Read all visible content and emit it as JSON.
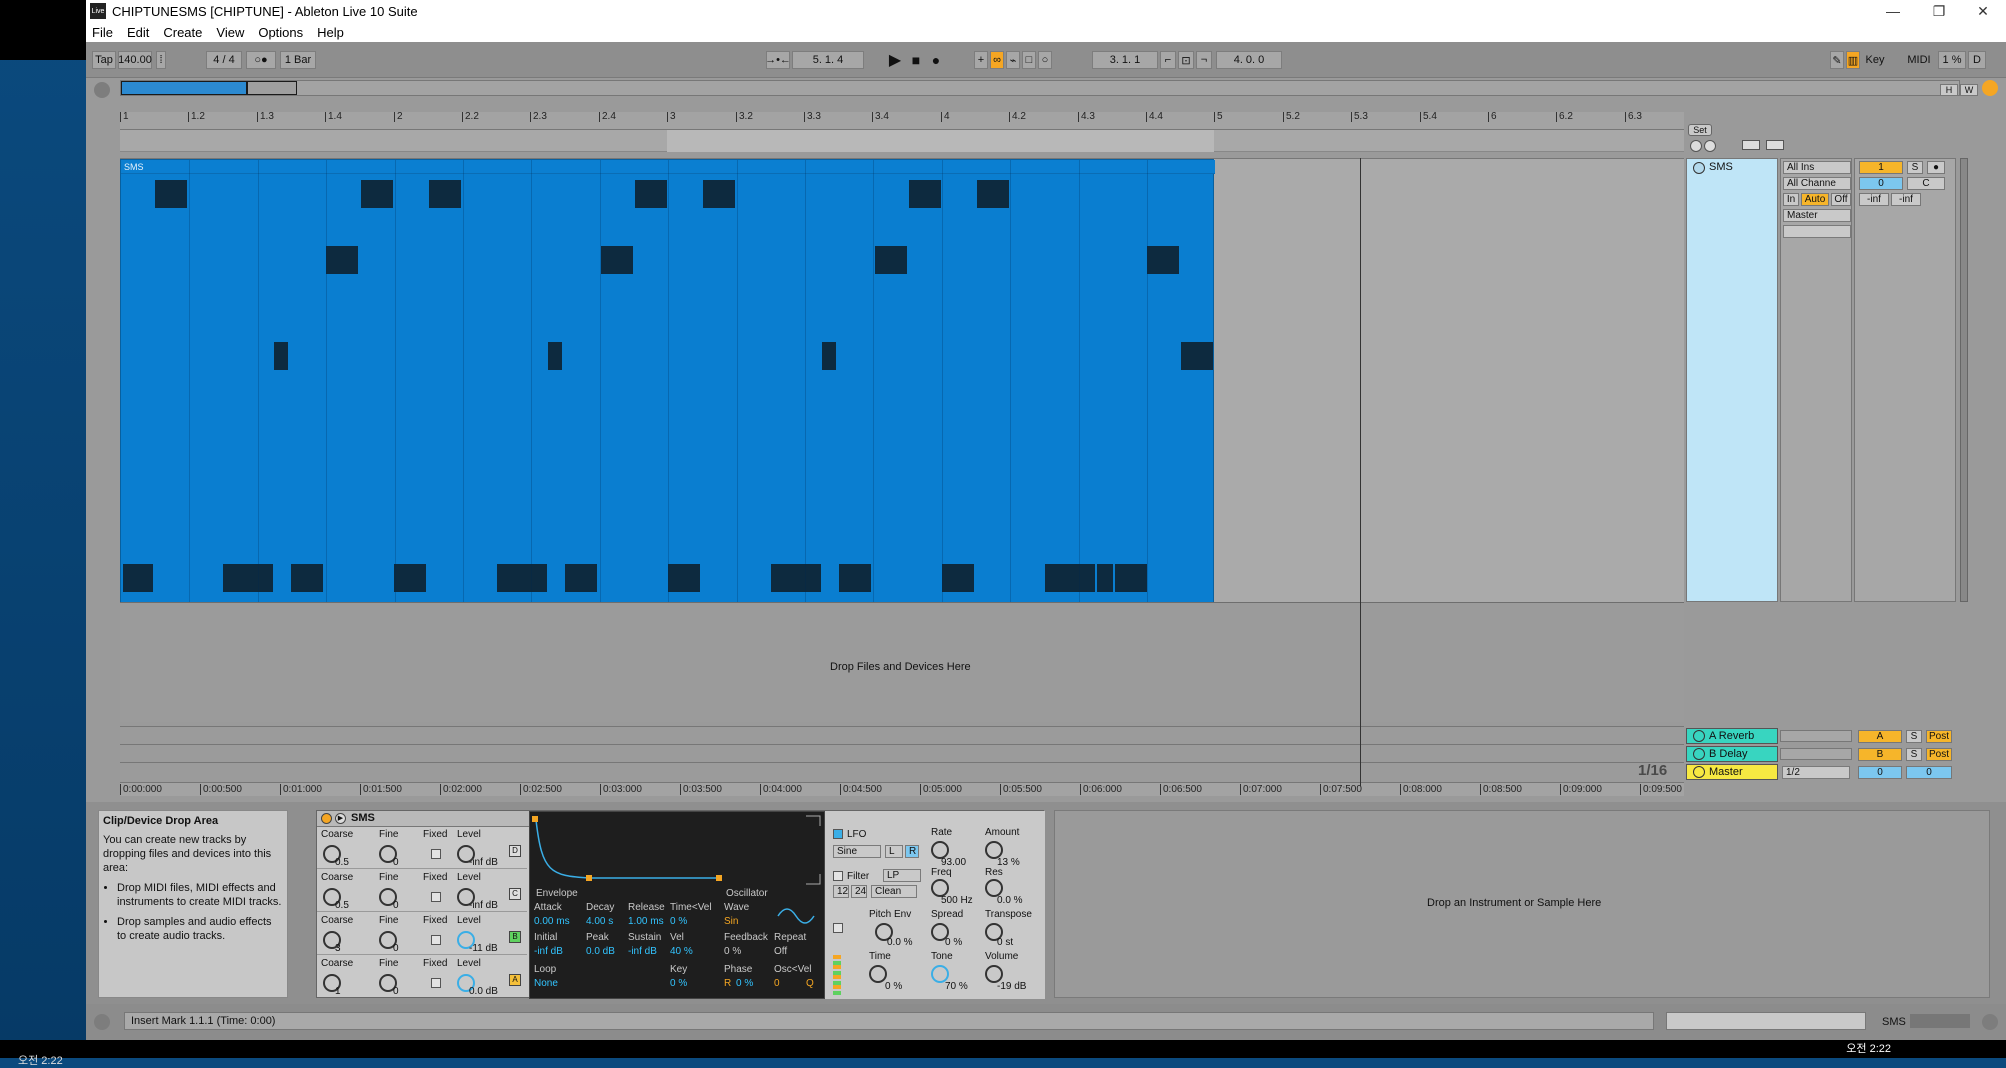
{
  "window": {
    "title": "CHIPTUNESMS  [CHIPTUNE] - Ableton Live 10 Suite",
    "logo": "Live",
    "minimize": "—",
    "restore": "❐",
    "close": "✕"
  },
  "menu": [
    "File",
    "Edit",
    "Create",
    "View",
    "Options",
    "Help"
  ],
  "transport": {
    "tap": "Tap",
    "tempo": "140.00",
    "signature": "4  /  4",
    "quantize": "1 Bar",
    "position": "5.   1.   4",
    "loop_start": "3.   1.   1",
    "loop_length": "4.   0.   0",
    "key": "Key",
    "midi": "MIDI",
    "cpu": "1 %",
    "d": "D"
  },
  "overview": {
    "h_button": "H",
    "w_button": "W"
  },
  "ruler": [
    "1",
    "1.2",
    "1.3",
    "1.4",
    "2",
    "2.2",
    "2.3",
    "2.4",
    "3",
    "3.2",
    "3.3",
    "3.4",
    "4",
    "4.2",
    "4.3",
    "4.4",
    "5",
    "5.2",
    "5.3",
    "5.4",
    "6",
    "6.2",
    "6.3"
  ],
  "set_label": "Set",
  "clip": {
    "name": "SMS"
  },
  "drop_text": "Drop Files and Devices Here",
  "time_ruler": [
    "0:00:000",
    "0:00:500",
    "0:01:000",
    "0:01:500",
    "0:02:000",
    "0:02:500",
    "0:03:000",
    "0:03:500",
    "0:04:000",
    "0:04:500",
    "0:05:000",
    "0:05:500",
    "0:06:000",
    "0:06:500",
    "0:07:000",
    "0:07:500",
    "0:08:000",
    "0:08:500",
    "0:09:000",
    "0:09:500"
  ],
  "grid_quant": "1/16",
  "mixer": {
    "track_name": "SMS",
    "input_type": "All Ins",
    "input_channel": "All Channe",
    "monitor_in": "In",
    "monitor_auto": "Auto",
    "monitor_off": "Off",
    "output": "Master",
    "track_number": "1",
    "solo": "S",
    "pan": "0",
    "c": "C",
    "meter_l": "-inf",
    "meter_r": "-inf"
  },
  "returns": [
    {
      "name": "A Reverb",
      "letter": "A",
      "solo": "S",
      "post": "Post"
    },
    {
      "name": "B Delay",
      "letter": "B",
      "solo": "S",
      "post": "Post"
    },
    {
      "name": "Master",
      "route": "1/2",
      "pan": "0",
      "vol": "0"
    }
  ],
  "help": {
    "title": "Clip/Device Drop Area",
    "intro": "You can create new tracks by dropping files and devices into this area:",
    "items": [
      "Drop MIDI files, MIDI effects and instruments to create MIDI tracks.",
      "Drop samples and audio effects to create audio tracks."
    ]
  },
  "device": {
    "name": "SMS",
    "operators": [
      {
        "coarse": "0.5",
        "fine": "0",
        "fixed": "Fixed",
        "level": "-inf dB",
        "letter": "D"
      },
      {
        "coarse": "0.5",
        "fine": "0",
        "fixed": "Fixed",
        "level": "-inf dB",
        "letter": "C"
      },
      {
        "coarse": "3",
        "fine": "0",
        "fixed": "Fixed",
        "level": "-11 dB",
        "letter": "B"
      },
      {
        "coarse": "1",
        "fine": "0",
        "fixed": "Fixed",
        "level": "0.0 dB",
        "letter": "A"
      }
    ],
    "labels": {
      "coarse": "Coarse",
      "fine": "Fine",
      "level": "Level"
    },
    "envelope": {
      "env_tab": "Envelope",
      "osc_tab": "Oscillator",
      "attack_l": "Attack",
      "attack": "0.00 ms",
      "decay_l": "Decay",
      "decay": "4.00 s",
      "release_l": "Release",
      "release": "1.00 ms",
      "tvel_l": "Time<Vel",
      "tvel": "0 %",
      "wave_l": "Wave",
      "wave": "Sin",
      "initial_l": "Initial",
      "initial": "-inf dB",
      "peak_l": "Peak",
      "peak": "0.0 dB",
      "sustain_l": "Sustain",
      "sustain": "-inf dB",
      "vel_l": "Vel",
      "vel": "40 %",
      "feedback_l": "Feedback",
      "feedback": "0 %",
      "repeat_l": "Repeat",
      "repeat": "Off",
      "loop_l": "Loop",
      "loop": "None",
      "key_l": "Key",
      "key": "0 %",
      "phase_l": "Phase",
      "phase": "0 %",
      "osc_l": "Osc<Vel",
      "osc": "0",
      "r": "R",
      "q": "Q"
    },
    "lfo": {
      "lfo_l": "LFO",
      "wave": "Sine",
      "l": "L",
      "r": "R",
      "rate_l": "Rate",
      "rate": "93.00",
      "amount_l": "Amount",
      "amount": "13 %",
      "filter_l": "Filter",
      "filter_type": "LP",
      "filter_12": "12",
      "filter_24": "24",
      "clean": "Clean",
      "freq_l": "Freq",
      "freq": "500 Hz",
      "res_l": "Res",
      "res": "0.0 %",
      "pitchenv_l": "Pitch Env",
      "pitchenv": "0.0 %",
      "spread_l": "Spread",
      "spread": "0 %",
      "transpose_l": "Transpose",
      "transpose": "0 st",
      "time_l": "Time",
      "time": "0 %",
      "tone_l": "Tone",
      "tone": "70 %",
      "volume_l": "Volume",
      "volume": "-19 dB"
    }
  },
  "instrument_drop": "Drop an Instrument or Sample Here",
  "status": "Insert Mark 1.1.1 (Time: 0:00)",
  "status_track": "SMS",
  "taskbar": {
    "clock_ampm": "오전 2:22",
    "left_time": "오전 2:22"
  },
  "colors": {
    "clip": "#0a7ed0",
    "note": "#0d2a3f",
    "track": "#bfe5f7",
    "return": "#38d5c0",
    "master": "#f7e942",
    "accent": "#f5a623"
  }
}
